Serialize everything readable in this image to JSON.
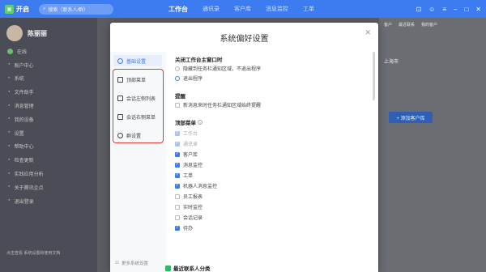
{
  "app": {
    "name": "开启",
    "search_placeholder": "搜索（联系人/群）",
    "top_nav": [
      "工作台",
      "通讯录",
      "客户库",
      "消息监控",
      "工单"
    ],
    "active_nav": "工作台"
  },
  "sidebar": {
    "user_name": "陈丽丽",
    "items": [
      "在线",
      "账户中心",
      "系统",
      "文件助手",
      "消息管理",
      "我的设备",
      "设置",
      "帮助中心",
      "检查更新",
      "实践应用分析",
      "关于腾讯企点",
      "退出登录"
    ],
    "footer": "点击查看 系统设置和使用文档"
  },
  "right_panel": {
    "tabs": [
      "客户",
      "最近联系",
      "我的客户"
    ],
    "location": "上海市",
    "add_button": "+ 添加客户库"
  },
  "modal": {
    "title": "系统偏好设置",
    "nav": [
      {
        "label": "基础设置",
        "active": true
      },
      {
        "label": "顶部菜单",
        "active": false
      },
      {
        "label": "会话左侧列表",
        "active": false
      },
      {
        "label": "会话右侧菜单",
        "active": false
      },
      {
        "label": "群设置",
        "active": false
      }
    ],
    "nav_footer": "更多系统设置",
    "close_section": {
      "title": "关闭工作台主窗口时",
      "options": [
        {
          "label": "隐藏到任务栏通知区域，不退出程序",
          "selected": false
        },
        {
          "label": "退出程序",
          "selected": true
        }
      ]
    },
    "reminder_section": {
      "title": "提醒",
      "options": [
        {
          "label": "新消息来时任务栏通知区域始终提醒",
          "checked": false
        }
      ]
    },
    "top_menu_section": {
      "title": "顶部菜单",
      "items": [
        {
          "label": "工作台",
          "checked": true,
          "disabled": true
        },
        {
          "label": "通讯录",
          "checked": true,
          "disabled": true
        },
        {
          "label": "客户库",
          "checked": true,
          "disabled": false
        },
        {
          "label": "消息监控",
          "checked": true,
          "disabled": false
        },
        {
          "label": "工单",
          "checked": true,
          "disabled": false
        },
        {
          "label": "机器人消息监控",
          "checked": true,
          "disabled": false
        },
        {
          "label": "员工报表",
          "checked": false,
          "disabled": false
        },
        {
          "label": "实时监控",
          "checked": false,
          "disabled": false
        },
        {
          "label": "会话记录",
          "checked": false,
          "disabled": false
        },
        {
          "label": "待办",
          "checked": true,
          "disabled": false
        }
      ]
    },
    "recent_section_title": "最近联系人分类"
  },
  "colors": {
    "accent": "#3d7cf0",
    "highlight": "#e53935",
    "topbar": "#3d7cf0"
  }
}
